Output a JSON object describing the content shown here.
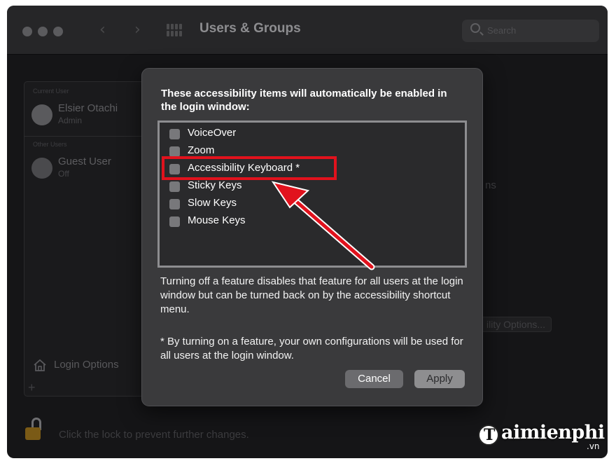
{
  "window": {
    "title": "Users & Groups",
    "search_placeholder": "Search",
    "back_icon": "chevron-left-icon",
    "forward_icon": "chevron-right-icon"
  },
  "sidebar": {
    "current_user_section": "Current User",
    "other_users_section": "Other Users",
    "users": [
      {
        "name": "Elsier Otachi",
        "role": "Admin"
      },
      {
        "name": "Guest User",
        "role": "Off"
      }
    ],
    "login_options_label": "Login Options",
    "add_button": "+"
  },
  "background": {
    "partial_text_ns": "ns",
    "partial_button": "ility Options..."
  },
  "lock_text": "Click the lock to prevent further changes.",
  "dialog": {
    "heading": "These accessibility items will automatically be enabled in the login window:",
    "items": [
      {
        "label": "VoiceOver",
        "checked": false
      },
      {
        "label": "Zoom",
        "checked": false
      },
      {
        "label": "Accessibility Keyboard *",
        "checked": false
      },
      {
        "label": "Sticky Keys",
        "checked": false
      },
      {
        "label": "Slow Keys",
        "checked": false
      },
      {
        "label": "Mouse Keys",
        "checked": false
      }
    ],
    "note": "Turning off a feature disables that feature for all users at the login window but can be turned back on by the accessibility shortcut menu.",
    "note2": "* By turning on a feature, your own configurations will be used for all users at the login window.",
    "cancel_label": "Cancel",
    "apply_label": "Apply"
  },
  "annotation": {
    "highlight_color": "#e1121d"
  },
  "watermark": {
    "brand": "aimienphi",
    "tld": ".vn"
  }
}
